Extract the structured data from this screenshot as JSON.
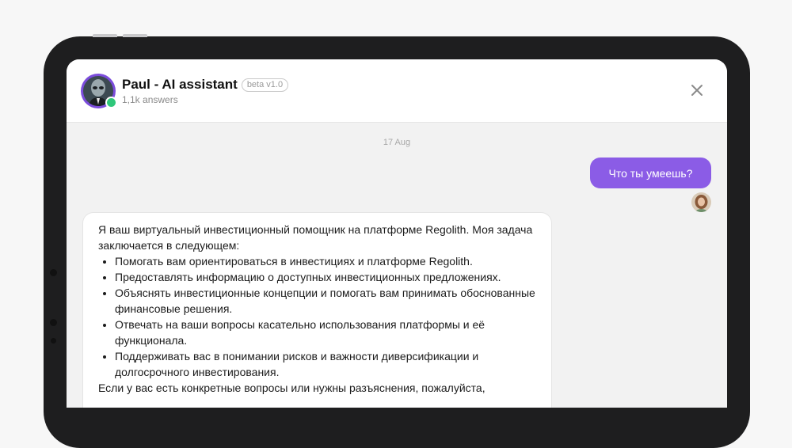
{
  "header": {
    "title": "Paul - AI assistant",
    "badge": "beta v1.0",
    "subtitle": "1,1k answers",
    "avatar_icon": "alien-avatar-icon",
    "status": "online",
    "close_icon": "close-icon"
  },
  "chat": {
    "date": "17 Aug",
    "user_message": "Что ты умеешь?",
    "bot_message": {
      "intro": "Я ваш виртуальный инвестиционный помощник на платформе Regolith. Моя задача заключается в следующем:",
      "items": [
        "Помогать вам ориентироваться в инвестициях и платформе Regolith.",
        "Предоставлять информацию о доступных инвестиционных предложениях.",
        "Объяснять инвестиционные концепции и помогать вам принимать обоснованные финансовые решения.",
        "Отвечать на ваши вопросы касательно использования платформы и её функционала.",
        "Поддерживать вас в понимании рисков и важности диверсификации и долгосрочного инвестирования."
      ],
      "outro": "Если у вас есть конкретные вопросы или нужны разъяснения, пожалуйста,"
    }
  },
  "colors": {
    "accent": "#8b5ce6",
    "online": "#2fc77a",
    "background": "#f2f2f2"
  }
}
